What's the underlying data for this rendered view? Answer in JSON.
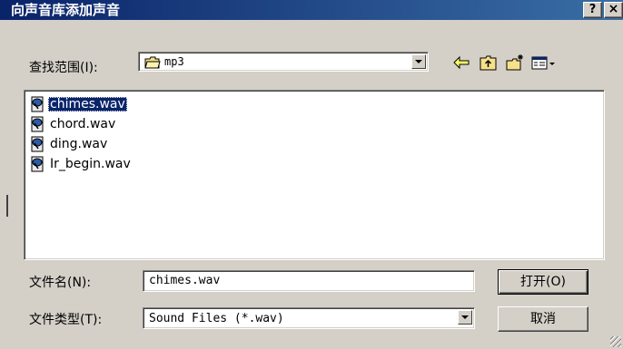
{
  "dialog": {
    "title": "向声音库添加声音",
    "help_label": "?",
    "close_label": "×"
  },
  "look_in": {
    "label": "查找范围(I):",
    "value": "mp3",
    "icon": "folder-icon"
  },
  "toolbar": {
    "icons": [
      "back-arrow-icon",
      "up-folder-icon",
      "new-folder-icon",
      "view-menu-icon"
    ]
  },
  "files": [
    {
      "name": "chimes.wav",
      "selected": true,
      "icon": "wav-file-icon"
    },
    {
      "name": "chord.wav",
      "selected": false,
      "icon": "wav-file-icon"
    },
    {
      "name": "ding.wav",
      "selected": false,
      "icon": "wav-file-icon"
    },
    {
      "name": "Ir_begin.wav",
      "selected": false,
      "icon": "wav-file-icon"
    }
  ],
  "file_name": {
    "label": "文件名(N):",
    "value": "chimes.wav"
  },
  "file_type": {
    "label": "文件类型(T):",
    "value": "Sound Files (*.wav)"
  },
  "buttons": {
    "open": "打开(O)",
    "cancel": "取消"
  },
  "colors": {
    "title_bar": "#0a246a",
    "selection": "#0a246a",
    "face": "#d4d0c8"
  }
}
